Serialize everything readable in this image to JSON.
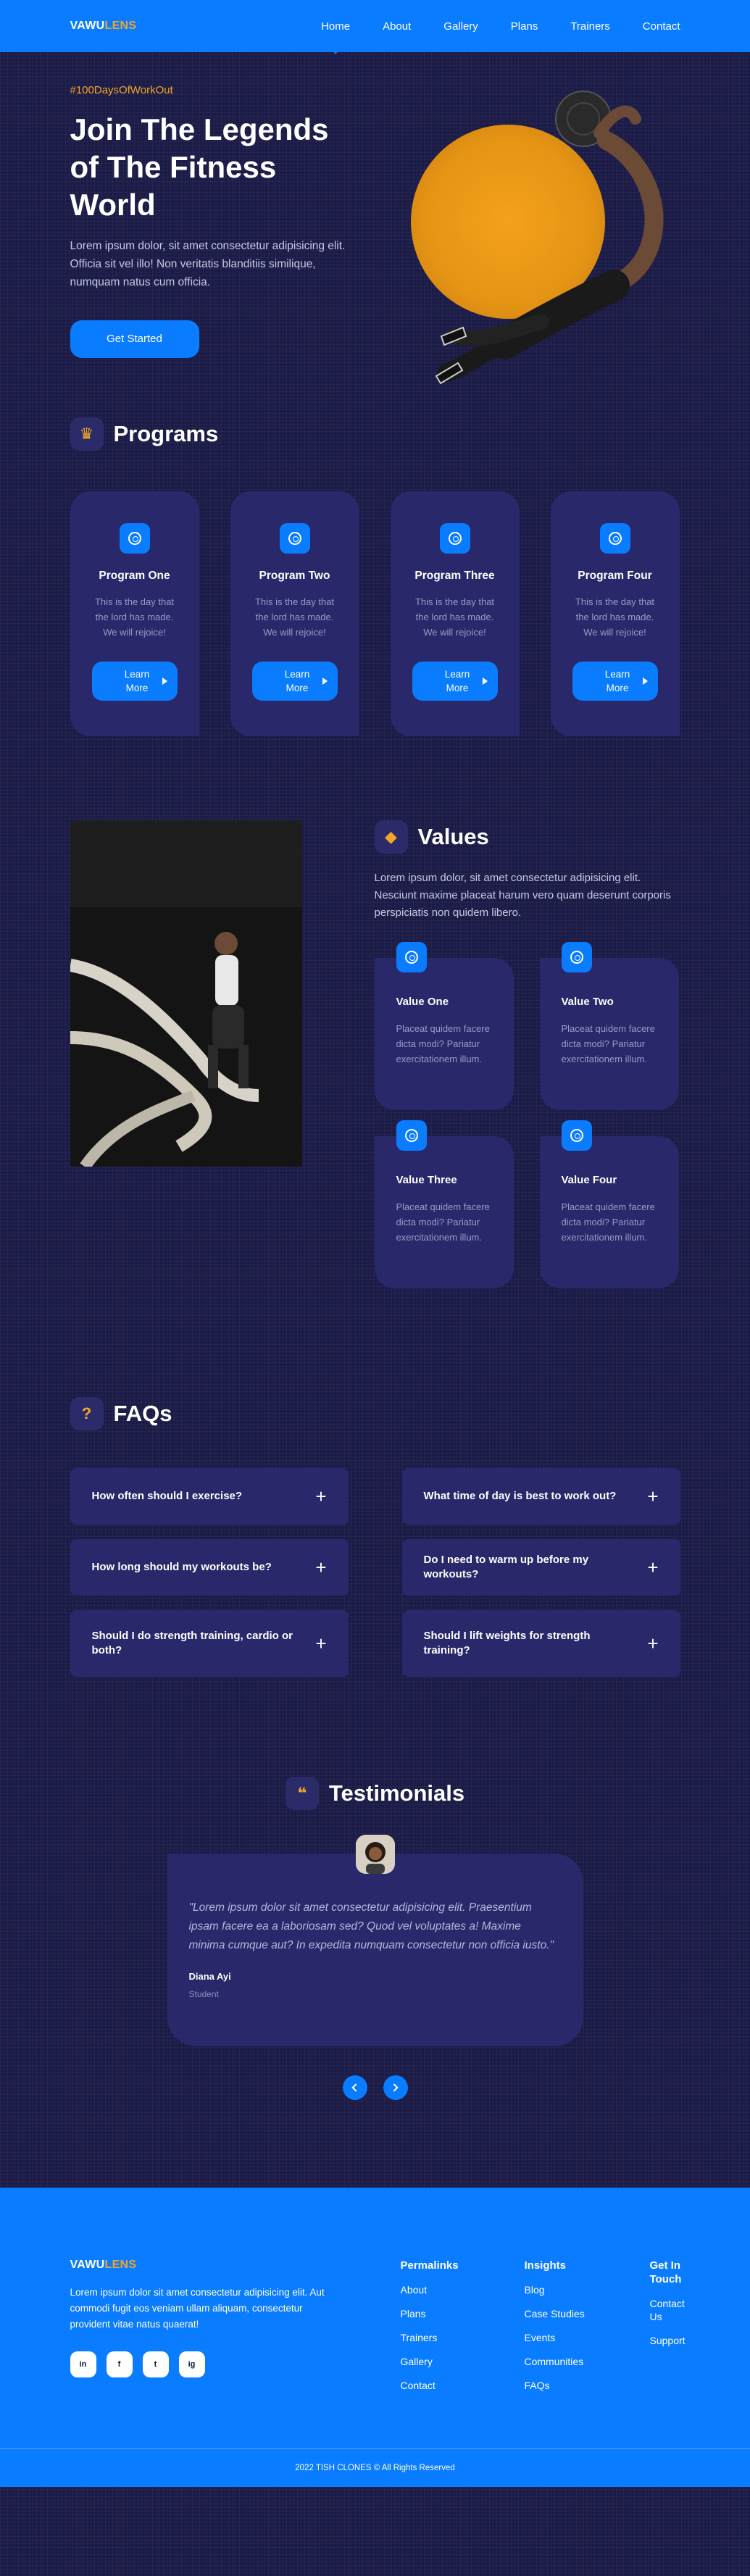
{
  "nav": {
    "logo_a": "VAWU",
    "logo_b": "LENS",
    "items": [
      "Home",
      "About",
      "Gallery",
      "Plans",
      "Trainers",
      "Contact"
    ],
    "active": "Home"
  },
  "hero": {
    "tag": "#100DaysOfWorkOut",
    "title": "Join The Legends of The Fitness World",
    "description": "Lorem ipsum dolor, sit amet consectetur adipisicing elit. Officia sit vel illo! Non veritatis blanditiis similique, numquam natus cum officia.",
    "cta": "Get Started"
  },
  "programs": {
    "heading": "Programs",
    "items": [
      {
        "title": "Program One",
        "text": "This is the day that the lord has made. We will rejoice!",
        "button": "Learn More"
      },
      {
        "title": "Program Two",
        "text": "This is the day that the lord has made. We will rejoice!",
        "button": "Learn More"
      },
      {
        "title": "Program Three",
        "text": "This is the day that the lord has made. We will rejoice!",
        "button": "Learn More"
      },
      {
        "title": "Program Four",
        "text": "This is the day that the lord has made. We will rejoice!",
        "button": "Learn More"
      }
    ]
  },
  "values": {
    "heading": "Values",
    "intro": "Lorem ipsum dolor, sit amet consectetur adipisicing elit. Nesciunt maxime placeat harum vero quam deserunt corporis perspiciatis non quidem libero.",
    "items": [
      {
        "title": "Value One",
        "text": "Placeat quidem facere dicta modi? Pariatur exercitationem illum."
      },
      {
        "title": "Value Two",
        "text": "Placeat quidem facere dicta modi? Pariatur exercitationem illum."
      },
      {
        "title": "Value Three",
        "text": "Placeat quidem facere dicta modi? Pariatur exercitationem illum."
      },
      {
        "title": "Value Four",
        "text": "Placeat quidem facere dicta modi? Pariatur exercitationem illum."
      }
    ]
  },
  "faqs": {
    "heading": "FAQs",
    "items": [
      "How often should I exercise?",
      "What time of day is best to work out?",
      "How long should my workouts be?",
      "Do I need to warm up before my workouts?",
      "Should I do strength training, cardio or both?",
      "Should I lift weights for strength training?"
    ]
  },
  "testimonials": {
    "heading": "Testimonials",
    "quote": "\"Lorem ipsum dolor sit amet consectetur adipisicing elit. Praesentium ipsam facere ea a laboriosam sed? Quod vel voluptates a! Maxime minima cumque aut? In expedita numquam consectetur non officia iusto.\"",
    "name": "Diana Ayi",
    "role": "Student"
  },
  "footer": {
    "logo_a": "VAWU",
    "logo_b": "LENS",
    "about": "Lorem ipsum dolor sit amet consectetur adipisicing elit. Aut commodi fugit eos veniam ullam aliquam, consectetur provident vitae natus quaerat!",
    "socials": [
      "in",
      "f",
      "t",
      "ig"
    ],
    "col1": {
      "title": "Permalinks",
      "links": [
        "About",
        "Plans",
        "Trainers",
        "Gallery",
        "Contact"
      ]
    },
    "col2": {
      "title": "Insights",
      "links": [
        "Blog",
        "Case Studies",
        "Events",
        "Communities",
        "FAQs"
      ]
    },
    "col3": {
      "title": "Get In Touch",
      "links": [
        "Contact Us",
        "Support"
      ]
    },
    "copyright": "2022 TISH CLONES © All Rights Reserved"
  },
  "colors": {
    "primary": "#0a7cff",
    "accent": "#f5a524",
    "background": "#1b1b47",
    "card": "#28286a"
  }
}
